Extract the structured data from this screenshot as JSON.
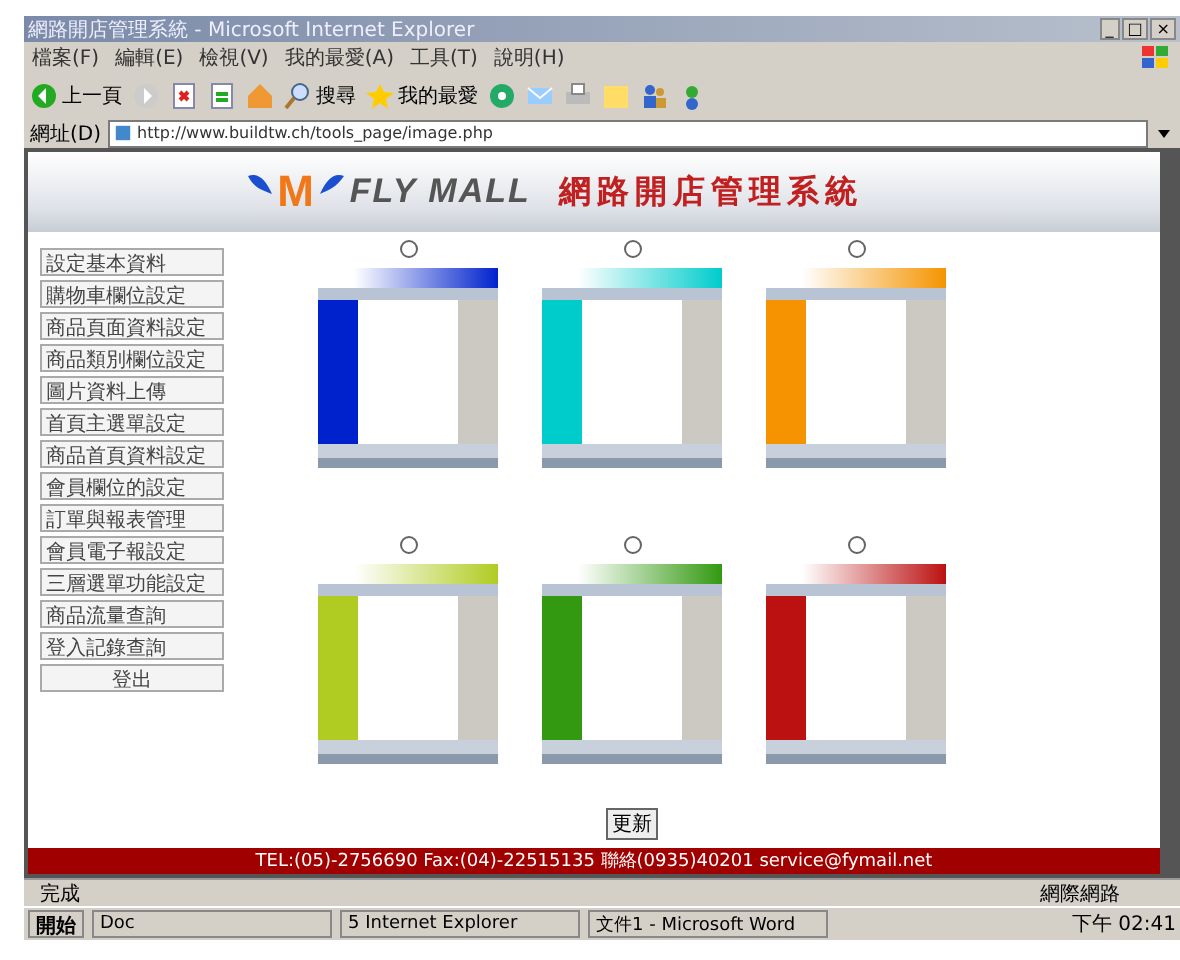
{
  "window": {
    "title": "網路開店管理系統 - Microsoft Internet Explorer",
    "controls": [
      "_",
      "□",
      "×"
    ]
  },
  "menu": [
    "檔案(F)",
    "編輯(E)",
    "檢視(V)",
    "我的最愛(A)",
    "工具(T)",
    "說明(H)"
  ],
  "toolbar": {
    "back": "上一頁",
    "search": "搜尋",
    "favorites": "我的最愛"
  },
  "address": {
    "label": "網址(D)",
    "value": "http://www.buildtw.ch/tools_page/image.php"
  },
  "header": {
    "logo_letter": "M",
    "logo_text": "FLY MALL",
    "system_title": "網路開店管理系統"
  },
  "sidebar": {
    "items": [
      "設定基本資料",
      "購物車欄位設定",
      "商品頁面資料設定",
      "商品類別欄位設定",
      "圖片資料上傳",
      "首頁主選單設定",
      "商品首頁資料設定",
      "會員欄位的設定",
      "訂單與報表管理",
      "會員電子報設定",
      "三層選單功能設定",
      "商品流量查詢",
      "登入記錄查詢",
      "登出"
    ]
  },
  "templates": [
    {
      "selected": false,
      "color": "#0022cc"
    },
    {
      "selected": false,
      "color": "#00cccc"
    },
    {
      "selected": false,
      "color": "#f59400"
    },
    {
      "selected": false,
      "color": "#b0cc22"
    },
    {
      "selected": false,
      "color": "#339911"
    },
    {
      "selected": false,
      "color": "#bb1111"
    }
  ],
  "update_button": "更新",
  "footer": "TEL:(05)-2756690 Fax:(04)-22515135 聯絡(0935)40201 service@fymail.net",
  "status_bar": {
    "text": "完成",
    "zone": "網際網路"
  },
  "taskbar": {
    "start": "開始",
    "tasks": [
      "Doc",
      "5 Internet Explorer",
      "文件1 - Microsoft Word"
    ],
    "clock": "下午 02:41"
  }
}
